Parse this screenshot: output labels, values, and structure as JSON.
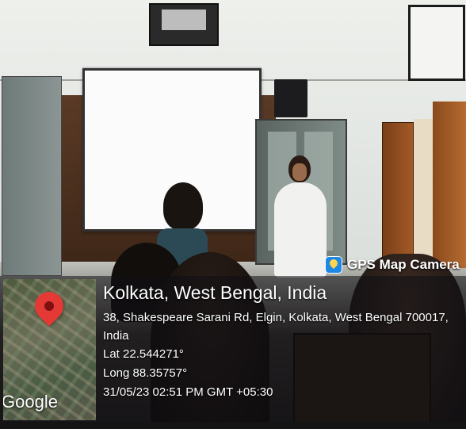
{
  "watermark": {
    "app_name": "GPS Map Camera",
    "icon": "gps-map-camera-icon"
  },
  "map": {
    "brand": "Google",
    "pin_icon": "map-pin-icon",
    "pin_color": "#e53935"
  },
  "location": {
    "title": "Kolkata, West Bengal, India",
    "address": "38, Shakespeare Sarani Rd, Elgin, Kolkata, West Bengal 700017, India",
    "lat": "Lat 22.544271°",
    "long": "Long 88.35757°",
    "timestamp": "31/05/23 02:51 PM GMT +05:30"
  }
}
